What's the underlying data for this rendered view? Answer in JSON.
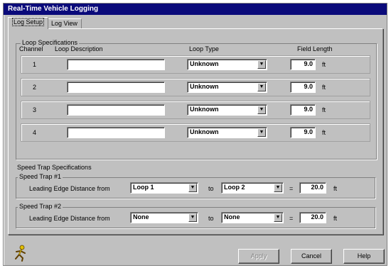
{
  "window": {
    "title": "Real-Time Vehicle Logging"
  },
  "tabs": [
    {
      "label": "Log Setup",
      "active": true
    },
    {
      "label": "Log View",
      "active": false
    }
  ],
  "loop_spec": {
    "title": "Loop Specifications",
    "headers": {
      "channel": "Channel",
      "description": "Loop Description",
      "type": "Loop Type",
      "length": "Field Length"
    },
    "rows": [
      {
        "channel": "1",
        "description": "",
        "type": "Unknown",
        "length": "9.0",
        "unit": "ft"
      },
      {
        "channel": "2",
        "description": "",
        "type": "Unknown",
        "length": "9.0",
        "unit": "ft"
      },
      {
        "channel": "3",
        "description": "",
        "type": "Unknown",
        "length": "9.0",
        "unit": "ft"
      },
      {
        "channel": "4",
        "description": "",
        "type": "Unknown",
        "length": "9.0",
        "unit": "ft"
      }
    ]
  },
  "speed_spec": {
    "title": "Speed Trap Specifications",
    "traps": [
      {
        "title": "Speed Trap #1",
        "lead_label": "Leading Edge Distance from",
        "from": "Loop 1",
        "to_label": "to",
        "to": "Loop 2",
        "eq": "=",
        "distance": "20.0",
        "unit": "ft"
      },
      {
        "title": "Speed Trap #2",
        "lead_label": "Leading Edge Distance from",
        "from": "None",
        "to_label": "to",
        "to": "None",
        "eq": "=",
        "distance": "20.0",
        "unit": "ft"
      }
    ]
  },
  "buttons": {
    "apply": "Apply",
    "cancel": "Cancel",
    "help": "Help"
  },
  "colors": {
    "titlebar": "#0a0a7a",
    "face": "#c0c0c0"
  },
  "icons": {
    "corner": "running-person-icon",
    "dropdown": "chevron-down-icon"
  }
}
